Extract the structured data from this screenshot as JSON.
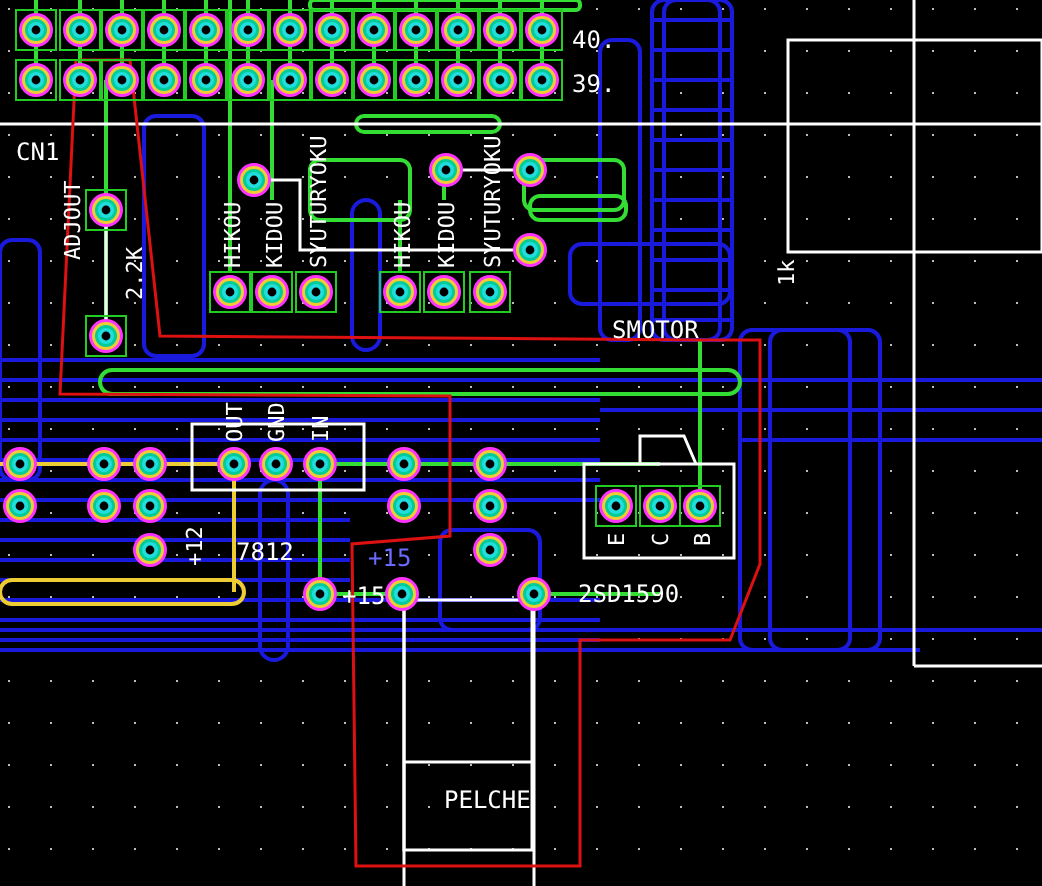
{
  "board": {
    "labels": [
      {
        "text": "40.",
        "kind": "silk"
      },
      {
        "text": "39.",
        "kind": "silk"
      },
      {
        "text": "CN1",
        "kind": "silk"
      },
      {
        "text": "ADJOUT",
        "kind": "vertical"
      },
      {
        "text": "2.2K",
        "kind": "vertical"
      },
      {
        "text": "HIKOU",
        "kind": "vertical"
      },
      {
        "text": "KIDOU",
        "kind": "vertical"
      },
      {
        "text": "SYUTURYOKU",
        "kind": "vertical"
      },
      {
        "text": "HIKOU",
        "kind": "vertical"
      },
      {
        "text": "KIDOU",
        "kind": "vertical"
      },
      {
        "text": "SYUTURYOKU",
        "kind": "vertical"
      },
      {
        "text": "SMOTOR",
        "kind": "silk"
      },
      {
        "text": "1k",
        "kind": "vertical"
      },
      {
        "text": "OUT",
        "kind": "vertical"
      },
      {
        "text": "GND",
        "kind": "vertical"
      },
      {
        "text": "IN",
        "kind": "vertical"
      },
      {
        "text": "+12",
        "kind": "vertical"
      },
      {
        "text": "7812",
        "kind": "silk"
      },
      {
        "text": "+15",
        "kind": "copper"
      },
      {
        "text": "+15",
        "kind": "silk"
      },
      {
        "text": "E",
        "kind": "vertical"
      },
      {
        "text": "C",
        "kind": "vertical"
      },
      {
        "text": "B",
        "kind": "vertical"
      },
      {
        "text": "2SD1590",
        "kind": "silk"
      },
      {
        "text": "PELCHE",
        "kind": "silk"
      }
    ]
  }
}
